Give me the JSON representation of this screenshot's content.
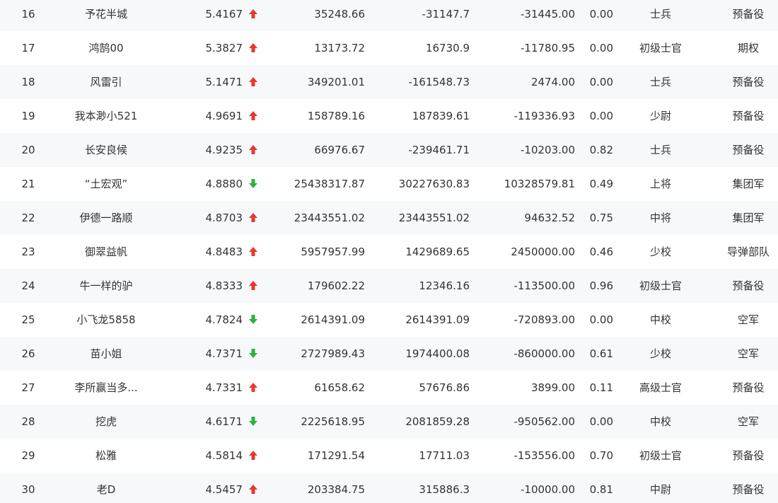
{
  "colors": {
    "up": "#e8382f",
    "down": "#27b33f"
  },
  "icons": {
    "up": "arrow-up-icon",
    "down": "arrow-down-icon"
  },
  "rows": [
    {
      "rank": "16",
      "name": "予花半城",
      "score": "5.4167",
      "trend": "up",
      "v1": "35248.66",
      "v2": "-31147.7",
      "v3": "-31445.00",
      "ratio": "0.00",
      "level": "士兵",
      "group": "预备役"
    },
    {
      "rank": "17",
      "name": "鸿鹄00",
      "score": "5.3827",
      "trend": "up",
      "v1": "13173.72",
      "v2": "16730.9",
      "v3": "-11780.95",
      "ratio": "0.00",
      "level": "初级士官",
      "group": "期权"
    },
    {
      "rank": "18",
      "name": "风雷引",
      "score": "5.1471",
      "trend": "up",
      "v1": "349201.01",
      "v2": "-161548.73",
      "v3": "2474.00",
      "ratio": "0.00",
      "level": "士兵",
      "group": "预备役"
    },
    {
      "rank": "19",
      "name": "我本渺小521",
      "score": "4.9691",
      "trend": "up",
      "v1": "158789.16",
      "v2": "187839.61",
      "v3": "-119336.93",
      "ratio": "0.00",
      "level": "少尉",
      "group": "预备役"
    },
    {
      "rank": "20",
      "name": "长安良候",
      "score": "4.9235",
      "trend": "up",
      "v1": "66976.67",
      "v2": "-239461.71",
      "v3": "-10203.00",
      "ratio": "0.82",
      "level": "士兵",
      "group": "预备役"
    },
    {
      "rank": "21",
      "name": "“土宏观”",
      "score": "4.8880",
      "trend": "down",
      "v1": "25438317.87",
      "v2": "30227630.83",
      "v3": "10328579.81",
      "ratio": "0.49",
      "level": "上将",
      "group": "集团军"
    },
    {
      "rank": "22",
      "name": "伊德一路顺",
      "score": "4.8703",
      "trend": "up",
      "v1": "23443551.02",
      "v2": "23443551.02",
      "v3": "94632.52",
      "ratio": "0.75",
      "level": "中将",
      "group": "集团军"
    },
    {
      "rank": "23",
      "name": "御翠益帆",
      "score": "4.8483",
      "trend": "up",
      "v1": "5957957.99",
      "v2": "1429689.65",
      "v3": "2450000.00",
      "ratio": "0.46",
      "level": "少校",
      "group": "导弹部队"
    },
    {
      "rank": "24",
      "name": "牛一样的驴",
      "score": "4.8333",
      "trend": "up",
      "v1": "179602.22",
      "v2": "12346.16",
      "v3": "-113500.00",
      "ratio": "0.96",
      "level": "初级士官",
      "group": "预备役"
    },
    {
      "rank": "25",
      "name": "小飞龙5858",
      "score": "4.7824",
      "trend": "down",
      "v1": "2614391.09",
      "v2": "2614391.09",
      "v3": "-720893.00",
      "ratio": "0.00",
      "level": "中校",
      "group": "空军"
    },
    {
      "rank": "26",
      "name": "苗小姐",
      "score": "4.7371",
      "trend": "down",
      "v1": "2727989.43",
      "v2": "1974400.08",
      "v3": "-860000.00",
      "ratio": "0.61",
      "level": "少校",
      "group": "空军"
    },
    {
      "rank": "27",
      "name": "李所赢当多...",
      "score": "4.7331",
      "trend": "up",
      "v1": "61658.62",
      "v2": "57676.86",
      "v3": "3899.00",
      "ratio": "0.11",
      "level": "高级士官",
      "group": "预备役"
    },
    {
      "rank": "28",
      "name": "挖虎",
      "score": "4.6171",
      "trend": "down",
      "v1": "2225618.95",
      "v2": "2081859.28",
      "v3": "-950562.00",
      "ratio": "0.00",
      "level": "中校",
      "group": "空军"
    },
    {
      "rank": "29",
      "name": "松雅",
      "score": "4.5814",
      "trend": "up",
      "v1": "171291.54",
      "v2": "17711.03",
      "v3": "-153556.00",
      "ratio": "0.70",
      "level": "初级士官",
      "group": "预备役"
    },
    {
      "rank": "30",
      "name": "老D",
      "score": "4.5457",
      "trend": "up",
      "v1": "203384.75",
      "v2": "315886.3",
      "v3": "-10000.00",
      "ratio": "0.81",
      "level": "中尉",
      "group": "预备役"
    }
  ]
}
